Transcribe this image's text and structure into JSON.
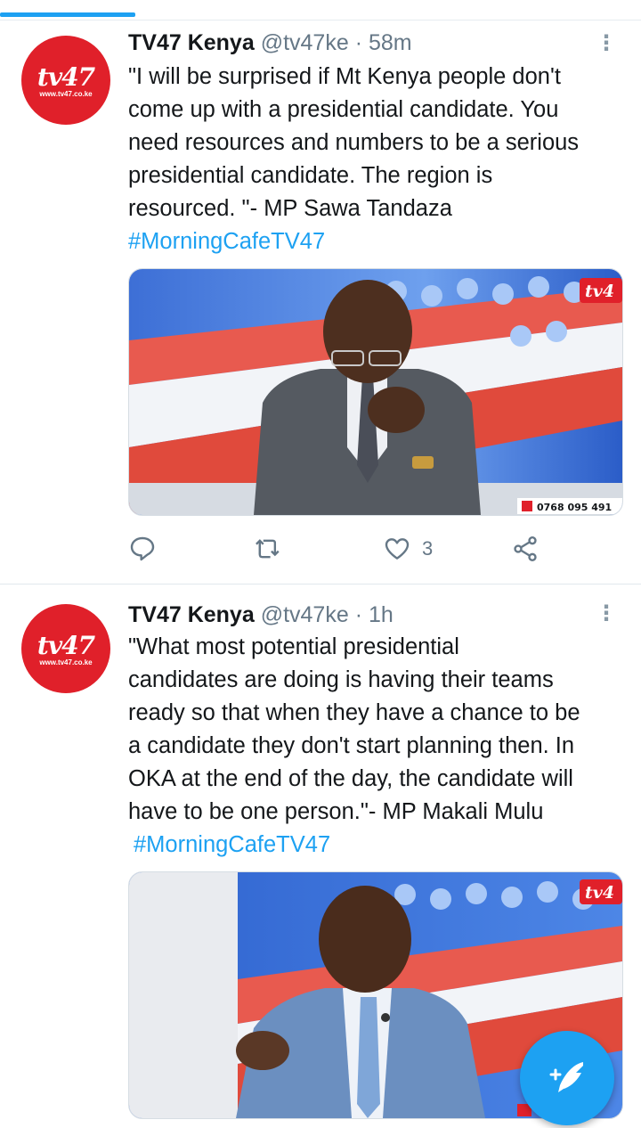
{
  "tweets": [
    {
      "avatar": {
        "logo": "tv47",
        "url": "www.tv47.co.ke"
      },
      "name": "TV47 Kenya",
      "handle": "@tv47ke",
      "time": "58m",
      "lines": [
        "\"I will be surprised if Mt Kenya people don't",
        "come up with a presidential candidate. You",
        "need resources and numbers to be a serious",
        "presidential candidate. The region is",
        "resourced. \"- MP Sawa Tandaza"
      ],
      "hashtag": "#MorningCafeTV47",
      "media": {
        "corner_logo": "tv4",
        "phone": "0768 095 491"
      },
      "actions": {
        "reply": "",
        "retweet": "",
        "like_count": "3",
        "share": ""
      }
    },
    {
      "avatar": {
        "logo": "tv47",
        "url": "www.tv47.co.ke"
      },
      "name": "TV47 Kenya",
      "handle": "@tv47ke",
      "time": "1h",
      "lines": [
        "\"What most potential presidential",
        "candidates are doing is having their teams",
        "ready so that when they have a chance to be",
        "a candidate they don't start planning then. In",
        "OKA at the end of the day, the candidate will",
        "have to be one person.\"- MP Makali Mulu"
      ],
      "hashtag": "#MorningCafeTV47",
      "media": {
        "corner_logo": "tv4"
      }
    }
  ],
  "colors": {
    "accent": "#1da1f2",
    "brand_red": "#e0202a",
    "meta_gray": "#657786"
  },
  "icons": [
    "reply-icon",
    "retweet-icon",
    "like-icon",
    "share-icon",
    "more-icon",
    "compose-icon"
  ]
}
